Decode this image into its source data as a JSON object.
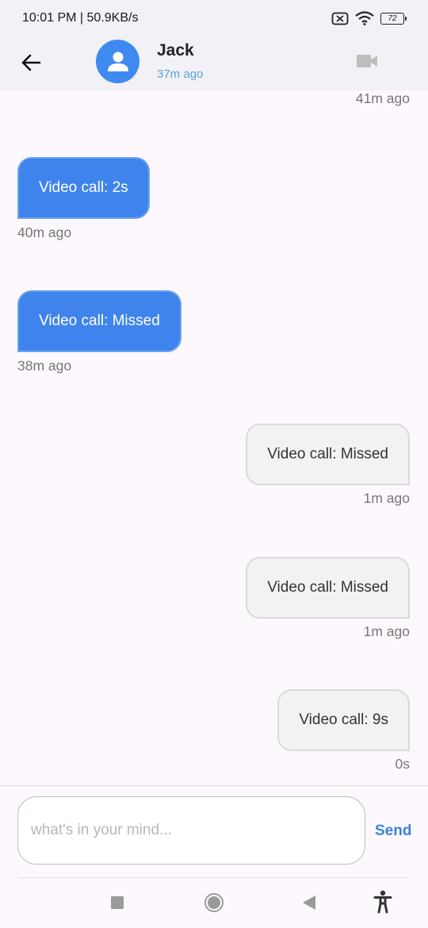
{
  "status_bar": {
    "time_speed": "10:01 PM | 50.9KB/s",
    "battery_level": "72"
  },
  "header": {
    "contact_name": "Jack",
    "last_seen": "37m ago"
  },
  "messages": [
    {
      "type": "timestamp",
      "text": "41m ago",
      "align": "right"
    },
    {
      "type": "sent",
      "text": "Video call: 2s",
      "time": "40m ago"
    },
    {
      "type": "sent",
      "text": "Video call: Missed",
      "time": "38m ago"
    },
    {
      "type": "received",
      "text": "Video call: Missed",
      "time": "1m ago"
    },
    {
      "type": "received",
      "text": "Video call: Missed",
      "time": "1m ago"
    },
    {
      "type": "received",
      "text": "Video call: 9s",
      "time": "0s"
    }
  ],
  "composer": {
    "placeholder": "what's in your mind...",
    "send_label": "Send"
  },
  "colors": {
    "accent": "#3f84ec",
    "header_bg": "#f1f1f6",
    "bubble_received": "#f2f2f2"
  },
  "icons": [
    "back-arrow-icon",
    "person-icon",
    "video-camera-icon",
    "nav-recents-icon",
    "nav-home-icon",
    "nav-back-icon",
    "accessibility-icon"
  ]
}
